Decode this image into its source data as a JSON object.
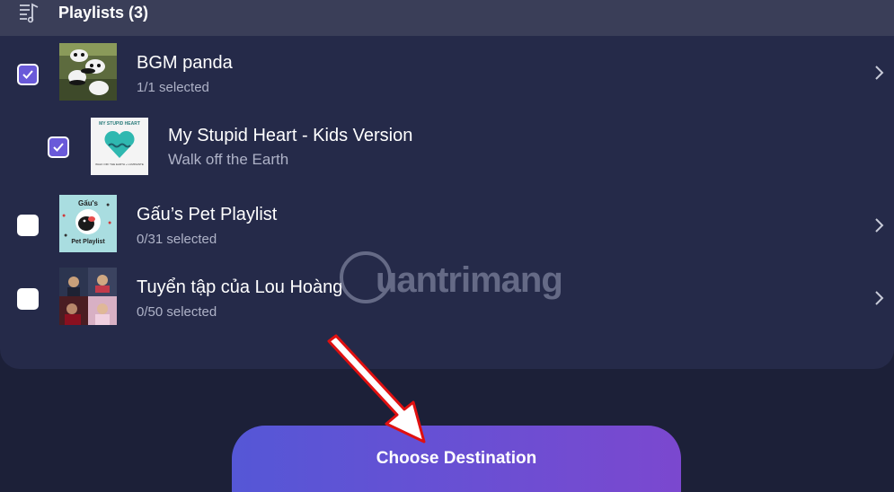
{
  "header": {
    "title": "Playlists (3)",
    "icon": "playlist-icon"
  },
  "playlists": [
    {
      "title": "BGM panda",
      "subtitle": "1/1 selected",
      "checked": true
    },
    {
      "title": "My Stupid Heart - Kids Version",
      "subtitle": "Walk off the Earth",
      "checked": true,
      "nested": true,
      "cover_text_top": "MY STUPID HEART",
      "cover_text_bottom": "WALK OFF THE EARTH + LUMINANTE"
    },
    {
      "title": "Gấu’s Pet Playlist",
      "subtitle": "0/31 selected",
      "checked": false,
      "cover_text_top": "Gấu's",
      "cover_text_bottom": "Pet Playlist"
    },
    {
      "title": "Tuyển tập của Lou Hoàng",
      "subtitle": "0/50 selected",
      "checked": false
    }
  ],
  "watermark": {
    "text": "uantrimang"
  },
  "cta": {
    "label": "Choose Destination"
  },
  "colors": {
    "accent": "#6a5ad9",
    "panel": "#252a49",
    "header": "#3a3e58",
    "arrow": "#e01010"
  }
}
